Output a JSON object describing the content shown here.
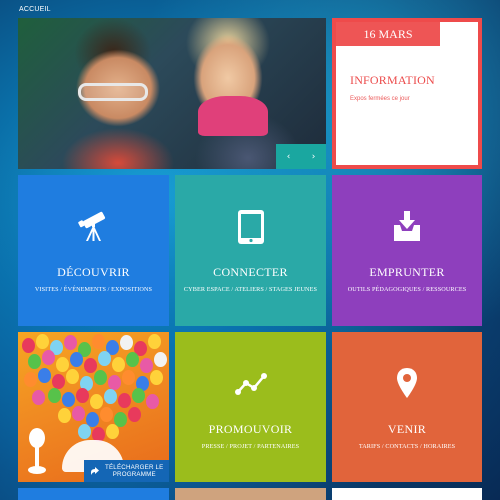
{
  "breadcrumb": {
    "label": "ACCUEIL"
  },
  "hero": {
    "prev": "‹",
    "next": "›"
  },
  "info": {
    "date": "16 MARS",
    "title": "INFORMATION",
    "text": "Expos fermées ce jour"
  },
  "tiles": [
    {
      "id": "decouvrir",
      "title": "DÉCOUVRIR",
      "sub": "VISITES / ÉVÉNEMENTS / EXPOSITIONS",
      "icon": "telescope-icon",
      "color": "#1f7de0"
    },
    {
      "id": "connecter",
      "title": "CONNECTER",
      "sub": "CYBER ESPACE / ATELIERS / STAGES JEUNES",
      "icon": "tablet-icon",
      "color": "#2aa9a7"
    },
    {
      "id": "emprunter",
      "title": "EMPRUNTER",
      "sub": "OUTILS PÉDAGOGIQUES / RESSOURCES",
      "icon": "inbox-download-icon",
      "color": "#8e3fbd"
    },
    {
      "id": "promouvoir",
      "title": "PROMOUVOIR",
      "sub": "PRESSE / PROJET / PARTENAIRES",
      "icon": "line-chart-icon",
      "color": "#9bbd1c"
    },
    {
      "id": "venir",
      "title": "VENIR",
      "sub": "TARIFS / CONTACTS / HORAIRES",
      "icon": "map-pin-icon",
      "color": "#e1643b"
    }
  ],
  "download": {
    "line1": "TÉLÉCHARGER LE",
    "line2": "PROGRAMME"
  }
}
